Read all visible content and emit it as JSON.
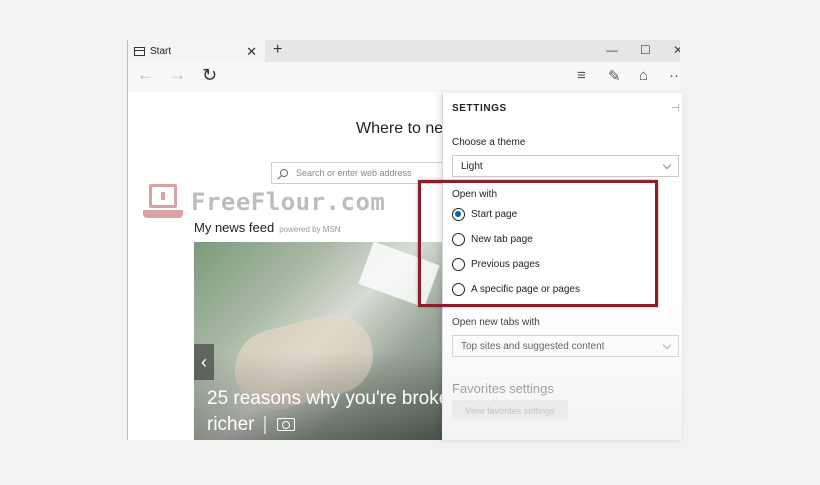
{
  "browser": {
    "tab_title": "Start",
    "tab_close": "✕",
    "new_tab": "+",
    "minimize": "—",
    "maximize": "☐",
    "close": "✕",
    "back": "←",
    "forward": "→",
    "reload": "↻",
    "reading_list": "≡",
    "web_note": "✎",
    "share": "⌂",
    "more": "···"
  },
  "start_page": {
    "heading": "Where to ne",
    "search_placeholder": "Search or enter web address",
    "news_feed_title": "My news feed",
    "news_feed_powered": "powered by MSN",
    "headline_line1": "25 reasons why you're broke",
    "headline_line2": "richer",
    "prev_arrow": "‹"
  },
  "watermark": {
    "text": "FreeFlour.com"
  },
  "settings": {
    "title": "SETTINGS",
    "pin": "⊣",
    "theme_label": "Choose a theme",
    "theme_value": "Light",
    "open_with_label": "Open with",
    "open_with_options": [
      {
        "label": "Start page",
        "checked": true
      },
      {
        "label": "New tab page",
        "checked": false
      },
      {
        "label": "Previous pages",
        "checked": false
      },
      {
        "label": "A specific page or pages",
        "checked": false
      }
    ],
    "new_tabs_label": "Open new tabs with",
    "new_tabs_value": "Top sites and suggested content",
    "favorites_heading": "Favorites settings",
    "favorites_button": "View favorites settings"
  },
  "colors": {
    "highlight_border": "#8a1f2b",
    "radio_accent": "#0063b1"
  }
}
